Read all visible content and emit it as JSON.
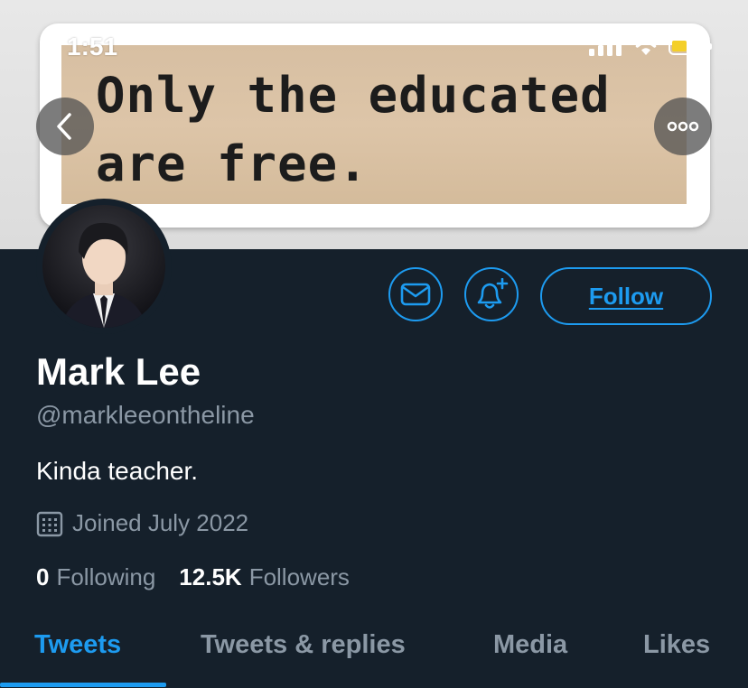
{
  "status_bar": {
    "time": "1:51"
  },
  "banner": {
    "quote_line1": "Only the educated",
    "quote_line2": "are free."
  },
  "profile": {
    "name": "Mark Lee",
    "handle": "@markleeontheline",
    "bio": "Kinda teacher.",
    "joined": "Joined July 2022",
    "following_count": "0",
    "following_label": "Following",
    "followers_count": "12.5K",
    "followers_label": "Followers"
  },
  "actions": {
    "follow_label": "Follow"
  },
  "tabs": [
    {
      "label": "Tweets",
      "active": true
    },
    {
      "label": "Tweets & replies",
      "active": false
    },
    {
      "label": "Media",
      "active": false
    },
    {
      "label": "Likes",
      "active": false
    }
  ],
  "colors": {
    "accent": "#1d9bf0",
    "background": "#15202b",
    "muted": "#8b98a5",
    "battery": "#f4cf29"
  }
}
